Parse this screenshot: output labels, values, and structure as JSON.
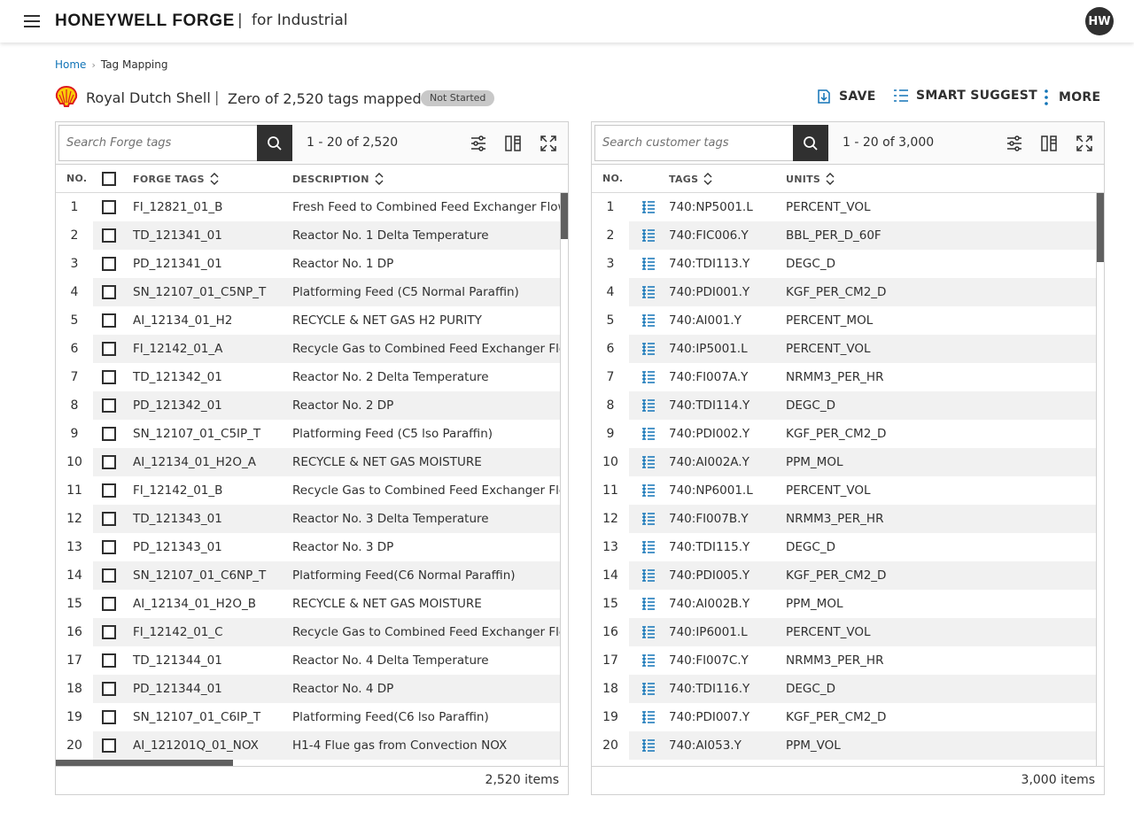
{
  "header": {
    "brand": "HONEYWELL FORGE",
    "separator": "|",
    "subtitle": "for Industrial",
    "avatar_initials": "HW"
  },
  "breadcrumb": {
    "home": "Home",
    "current": "Tag Mapping"
  },
  "title_row": {
    "client": "Royal Dutch Shell",
    "separator": "|",
    "mapped_summary": "Zero of 2,520 tags mapped",
    "status": "Not Started"
  },
  "actions": {
    "save": "SAVE",
    "smart_suggest": "SMART SUGGEST",
    "more": "MORE"
  },
  "colors": {
    "accent": "#1274b7",
    "dark": "#303030",
    "shell_red": "#dd1d21",
    "shell_yellow": "#fbce07"
  },
  "left_panel": {
    "search_placeholder": "Search Forge tags",
    "paging": "1 - 20 of 2,520",
    "headers": {
      "no": "NO.",
      "tags": "FORGE TAGS",
      "description": "DESCRIPTION"
    },
    "footer": "2,520 items",
    "scroll_fraction": 0.08,
    "rows": [
      {
        "no": "1",
        "tag": "FI_12821_01_B",
        "description": "Fresh Feed to Combined Feed Exchanger Flow"
      },
      {
        "no": "2",
        "tag": "TD_121341_01",
        "description": "Reactor No. 1 Delta Temperature"
      },
      {
        "no": "3",
        "tag": "PD_121341_01",
        "description": "Reactor No. 1 DP"
      },
      {
        "no": "4",
        "tag": "SN_12107_01_C5NP_T",
        "description": "Platforming Feed (C5 Normal Paraffin)"
      },
      {
        "no": "5",
        "tag": "AI_12134_01_H2",
        "description": "RECYCLE & NET GAS H2 PURITY"
      },
      {
        "no": "6",
        "tag": "FI_12142_01_A",
        "description": "Recycle Gas to Combined Feed Exchanger Flo"
      },
      {
        "no": "7",
        "tag": "TD_121342_01",
        "description": "Reactor No. 2 Delta Temperature"
      },
      {
        "no": "8",
        "tag": "PD_121342_01",
        "description": "Reactor No. 2 DP"
      },
      {
        "no": "9",
        "tag": "SN_12107_01_C5IP_T",
        "description": "Platforming Feed (C5 lso Paraffin)"
      },
      {
        "no": "10",
        "tag": "AI_12134_01_H2O_A",
        "description": "RECYCLE & NET GAS MOISTURE"
      },
      {
        "no": "11",
        "tag": "FI_12142_01_B",
        "description": "Recycle Gas to Combined Feed Exchanger Flo"
      },
      {
        "no": "12",
        "tag": "TD_121343_01",
        "description": "Reactor No. 3 Delta Temperature"
      },
      {
        "no": "13",
        "tag": "PD_121343_01",
        "description": "Reactor No. 3 DP"
      },
      {
        "no": "14",
        "tag": "SN_12107_01_C6NP_T",
        "description": "Platforming Feed(C6 Normal Paraffin)"
      },
      {
        "no": "15",
        "tag": "AI_12134_01_H2O_B",
        "description": "RECYCLE & NET GAS MOISTURE"
      },
      {
        "no": "16",
        "tag": "FI_12142_01_C",
        "description": "Recycle Gas to Combined Feed Exchanger Flo"
      },
      {
        "no": "17",
        "tag": "TD_121344_01",
        "description": "Reactor No. 4 Delta Temperature"
      },
      {
        "no": "18",
        "tag": "PD_121344_01",
        "description": "Reactor No. 4 DP"
      },
      {
        "no": "19",
        "tag": "SN_12107_01_C6IP_T",
        "description": "Platforming Feed(C6 lso Paraffin)"
      },
      {
        "no": "20",
        "tag": "AI_121201Q_01_NOX",
        "description": "H1-4 Flue gas from Convection NOX"
      }
    ]
  },
  "right_panel": {
    "search_placeholder": "Search customer tags",
    "paging": "1 - 20 of 3,000",
    "headers": {
      "no": "NO.",
      "tags": "TAGS",
      "units": "UNITS"
    },
    "footer": "3,000 items",
    "scroll_fraction": 0.12,
    "rows": [
      {
        "no": "1",
        "tag": "740:NP5001.L",
        "unit": "PERCENT_VOL"
      },
      {
        "no": "2",
        "tag": "740:FIC006.Y",
        "unit": "BBL_PER_D_60F"
      },
      {
        "no": "3",
        "tag": "740:TDI113.Y",
        "unit": "DEGC_D"
      },
      {
        "no": "4",
        "tag": "740:PDI001.Y",
        "unit": "KGF_PER_CM2_D"
      },
      {
        "no": "5",
        "tag": "740:AI001.Y",
        "unit": "PERCENT_MOL"
      },
      {
        "no": "6",
        "tag": "740:IP5001.L",
        "unit": "PERCENT_VOL"
      },
      {
        "no": "7",
        "tag": "740:FI007A.Y",
        "unit": "NRMM3_PER_HR"
      },
      {
        "no": "8",
        "tag": "740:TDI114.Y",
        "unit": "DEGC_D"
      },
      {
        "no": "9",
        "tag": "740:PDI002.Y",
        "unit": "KGF_PER_CM2_D"
      },
      {
        "no": "10",
        "tag": "740:AI002A.Y",
        "unit": "PPM_MOL"
      },
      {
        "no": "11",
        "tag": "740:NP6001.L",
        "unit": "PERCENT_VOL"
      },
      {
        "no": "12",
        "tag": "740:FI007B.Y",
        "unit": "NRMM3_PER_HR"
      },
      {
        "no": "13",
        "tag": "740:TDI115.Y",
        "unit": "DEGC_D"
      },
      {
        "no": "14",
        "tag": "740:PDI005.Y",
        "unit": "KGF_PER_CM2_D"
      },
      {
        "no": "15",
        "tag": "740:AI002B.Y",
        "unit": "PPM_MOL"
      },
      {
        "no": "16",
        "tag": "740:IP6001.L",
        "unit": "PERCENT_VOL"
      },
      {
        "no": "17",
        "tag": "740:FI007C.Y",
        "unit": "NRMM3_PER_HR"
      },
      {
        "no": "18",
        "tag": "740:TDI116.Y",
        "unit": "DEGC_D"
      },
      {
        "no": "19",
        "tag": "740:PDI007.Y",
        "unit": "KGF_PER_CM2_D"
      },
      {
        "no": "20",
        "tag": "740:AI053.Y",
        "unit": "PPM_VOL"
      }
    ]
  },
  "icons": {
    "menu": "hamburger-icon",
    "search": "search-icon",
    "filter": "sliders-icon",
    "columns": "columns-icon",
    "expand": "expand-icon",
    "save": "save-icon",
    "smart_suggest": "list-icon",
    "more": "more-vertical-icon",
    "sort": "sort-icon",
    "tag_row": "tag-list-icon"
  }
}
